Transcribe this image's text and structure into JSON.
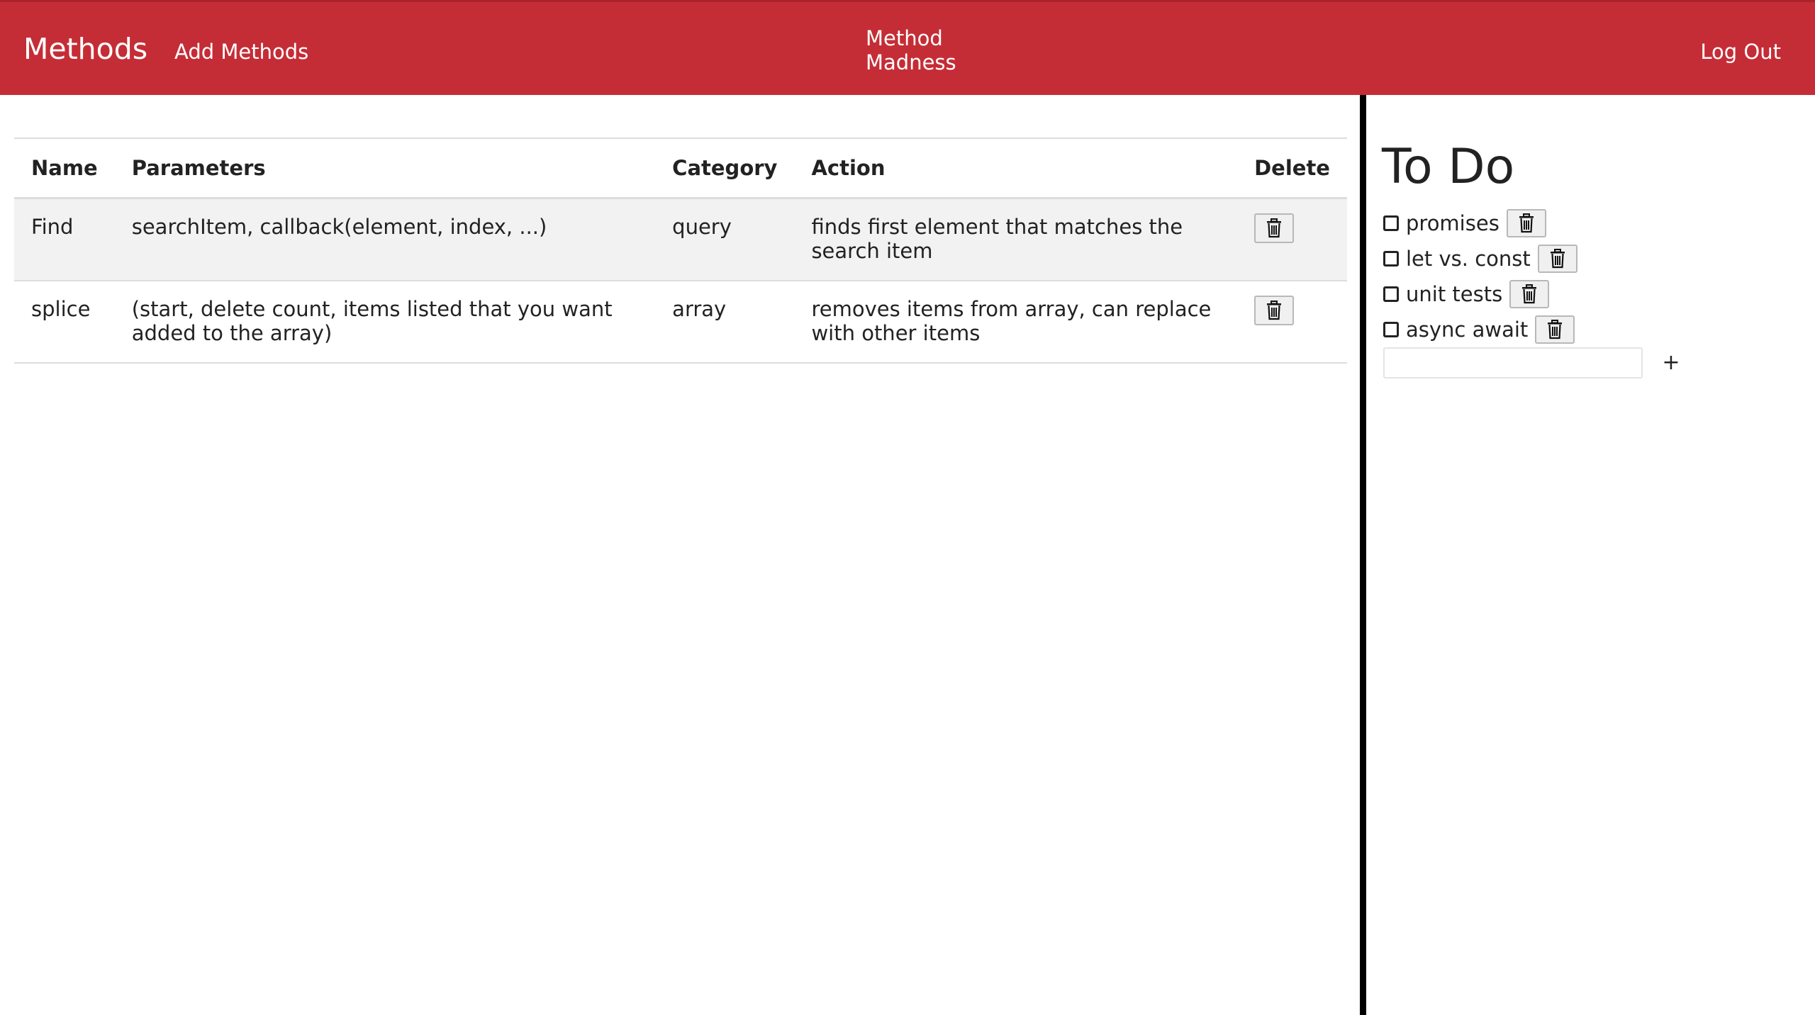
{
  "navbar": {
    "brand": "Methods",
    "add_methods": "Add Methods",
    "title": "Method Madness",
    "logout": "Log Out",
    "background_color": "#c52d36"
  },
  "table": {
    "headers": [
      "Name",
      "Parameters",
      "Category",
      "Action",
      "Delete"
    ],
    "rows": [
      {
        "name": "Find",
        "parameters": "searchItem, callback(element, index, ...)",
        "category": "query",
        "action": "finds first element that matches the search item",
        "delete_icon": "trash-icon"
      },
      {
        "name": "splice",
        "parameters": "(start, delete count, items listed that you want added to the array)",
        "category": "array",
        "action": "removes items from array, can replace with other items",
        "delete_icon": "trash-icon"
      }
    ]
  },
  "todo": {
    "title": "To Do",
    "items": [
      {
        "label": "promises",
        "checked": false
      },
      {
        "label": "let vs. const",
        "checked": false
      },
      {
        "label": "unit tests",
        "checked": false
      },
      {
        "label": "async await",
        "checked": false
      }
    ],
    "input_value": "",
    "add_label": "+"
  }
}
